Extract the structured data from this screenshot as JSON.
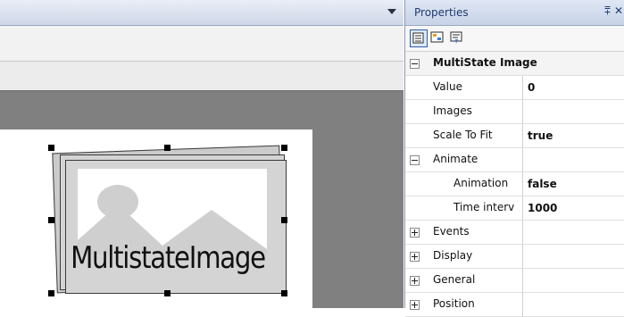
{
  "panel": {
    "title": "Properties",
    "pin_glyph": "⩱",
    "close_glyph": "✕",
    "toolbar": [
      {
        "name": "categorized-view-icon"
      },
      {
        "name": "alphabetical-view-icon"
      },
      {
        "name": "events-view-icon"
      }
    ]
  },
  "properties": {
    "group_title": "MultiState Image",
    "value_label": "Value",
    "value_value": "0",
    "images_label": "Images",
    "images_value": "",
    "scale_label": "Scale To Fit",
    "scale_value": "true",
    "animate_label": "Animate",
    "animation_label": "Animation",
    "animation_value": "false",
    "time_label": "Time interv",
    "time_value": "1000",
    "events_label": "Events",
    "display_label": "Display",
    "general_label": "General",
    "position_label": "Position"
  },
  "canvas": {
    "widget_label": "MultistateImage"
  },
  "colors": {
    "editor_bg": "#808080",
    "panel_header": "#c7d3e8",
    "selection_handle": "#000000"
  }
}
